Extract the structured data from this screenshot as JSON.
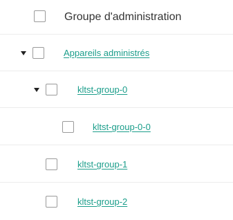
{
  "header": {
    "column_title": "Groupe d'administration"
  },
  "tree": {
    "root": {
      "label": "Appareils administrés",
      "expanded": true
    },
    "group0": {
      "label": "kltst-group-0",
      "expanded": true
    },
    "group0_0": {
      "label": "kltst-group-0-0"
    },
    "group1": {
      "label": "kltst-group-1"
    },
    "group2": {
      "label": "kltst-group-2"
    }
  },
  "colors": {
    "link": "#1a9d8a",
    "checkbox_border": "#9a9a9a"
  },
  "icons": {
    "expand": "caret-down-icon"
  }
}
